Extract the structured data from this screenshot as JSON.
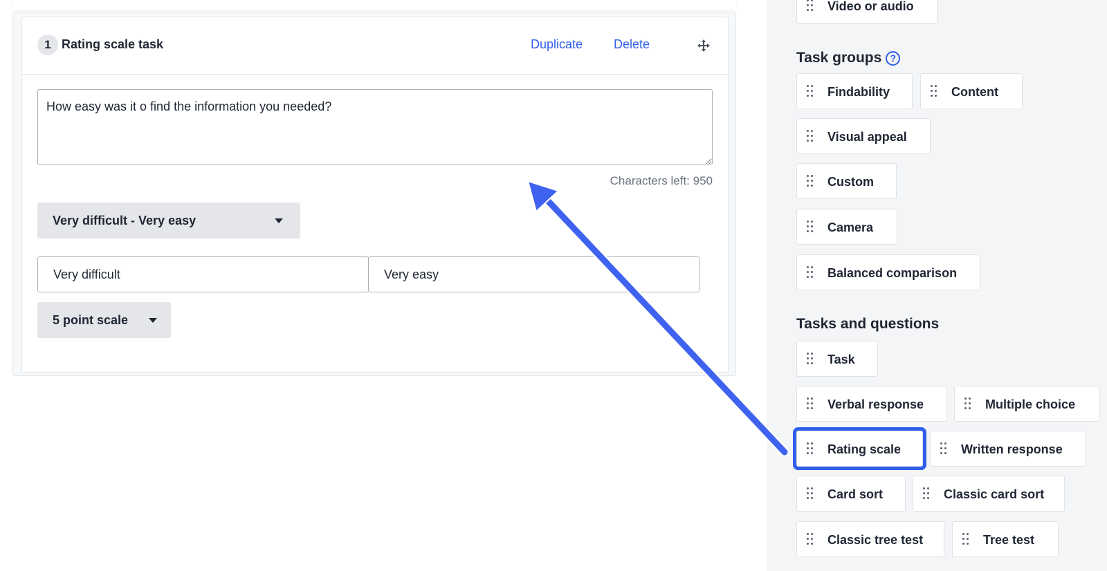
{
  "task_card": {
    "number": "1",
    "title": "Rating scale task",
    "duplicate_label": "Duplicate",
    "delete_label": "Delete",
    "question": "How easy was it o find the information you needed?",
    "chars_left": "Characters left: 950",
    "scale_type": "Very difficult - Very easy",
    "low_label": "Very difficult",
    "high_label": "Very easy",
    "points": "5 point scale"
  },
  "sidebar": {
    "media_item": "Video or audio",
    "task_groups_title": "Task groups",
    "help_glyph": "?",
    "task_groups": [
      "Findability",
      "Content",
      "Visual appeal",
      "Custom",
      "Camera",
      "Balanced comparison"
    ],
    "tasks_title": "Tasks and questions",
    "tasks": [
      "Task",
      "Verbal response",
      "Multiple choice",
      "Rating scale",
      "Written response",
      "Card sort",
      "Classic card sort",
      "Classic tree test",
      "Tree test"
    ],
    "highlighted": "Rating scale"
  },
  "colors": {
    "accent": "#2f5ee8",
    "arrow": "#3f63f0"
  },
  "icons": [
    "move-icon",
    "drag-handle-icon",
    "help-icon",
    "caret-down-icon",
    "arrow-annotation"
  ]
}
